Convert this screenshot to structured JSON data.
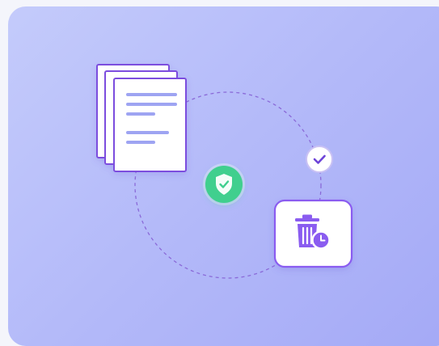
{
  "illustration": {
    "icons": {
      "documents": "document-stack-icon",
      "shield": "shield-check-icon",
      "check": "check-badge-icon",
      "trash": "trash-clock-icon"
    },
    "colors": {
      "background_start": "#c4cbfb",
      "background_end": "#a4a9f6",
      "accent_purple": "#7c4dde",
      "document_lines": "#9ea4f2",
      "shield_green": "#3fcf8e",
      "trash_purple": "#8a5cf0",
      "dashed_circle": "#8a6ad8"
    }
  }
}
